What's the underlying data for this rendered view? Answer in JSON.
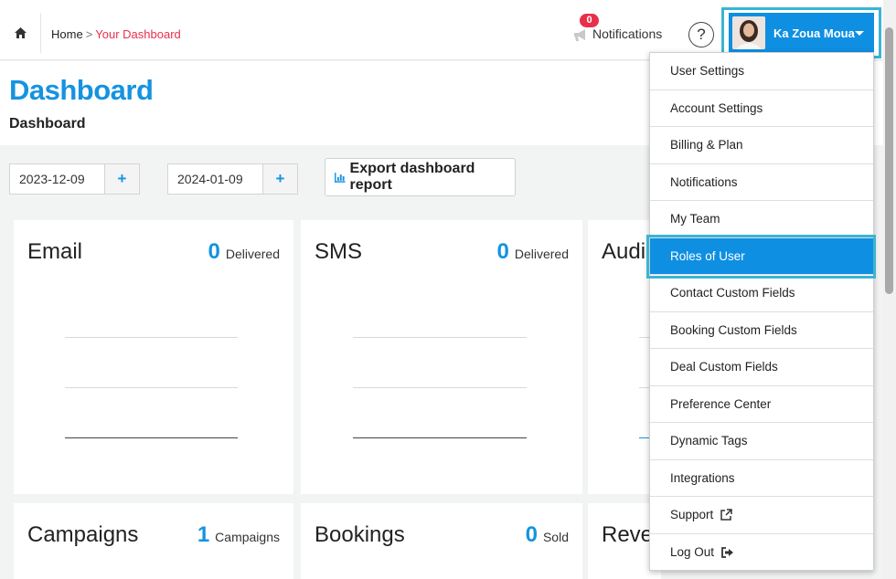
{
  "breadcrumb": {
    "home": "Home",
    "separator": ">",
    "current": "Your Dashboard"
  },
  "notifications": {
    "count": "0",
    "label": "Notifications"
  },
  "help": {
    "symbol": "?"
  },
  "user": {
    "name": "Ka Zoua Moua"
  },
  "page": {
    "title": "Dashboard",
    "subtitle": "Dashboard"
  },
  "filters": {
    "start_date": "2023-12-09",
    "end_date": "2024-01-09",
    "plus": "+",
    "export_label": "Export dashboard report"
  },
  "cards": {
    "email": {
      "title": "Email",
      "value": "0",
      "unit": "Delivered"
    },
    "sms": {
      "title": "SMS",
      "value": "0",
      "unit": "Delivered"
    },
    "audience": {
      "title": "Audi"
    },
    "campaigns": {
      "title": "Campaigns",
      "value": "1",
      "unit": "Campaigns"
    },
    "bookings": {
      "title": "Bookings",
      "value": "0",
      "unit": "Sold"
    },
    "revenue": {
      "title": "Reve"
    }
  },
  "menu": {
    "items": [
      "User Settings",
      "Account Settings",
      "Billing & Plan",
      "Notifications",
      "My Team",
      "Roles of User",
      "Contact Custom Fields",
      "Booking Custom Fields",
      "Deal Custom Fields",
      "Preference Center",
      "Dynamic Tags",
      "Integrations",
      "Support",
      "Log Out"
    ],
    "active": "Roles of User"
  },
  "colors": {
    "accent": "#1593e0",
    "highlight": "#3ab5d4",
    "badge": "#e8304a"
  }
}
